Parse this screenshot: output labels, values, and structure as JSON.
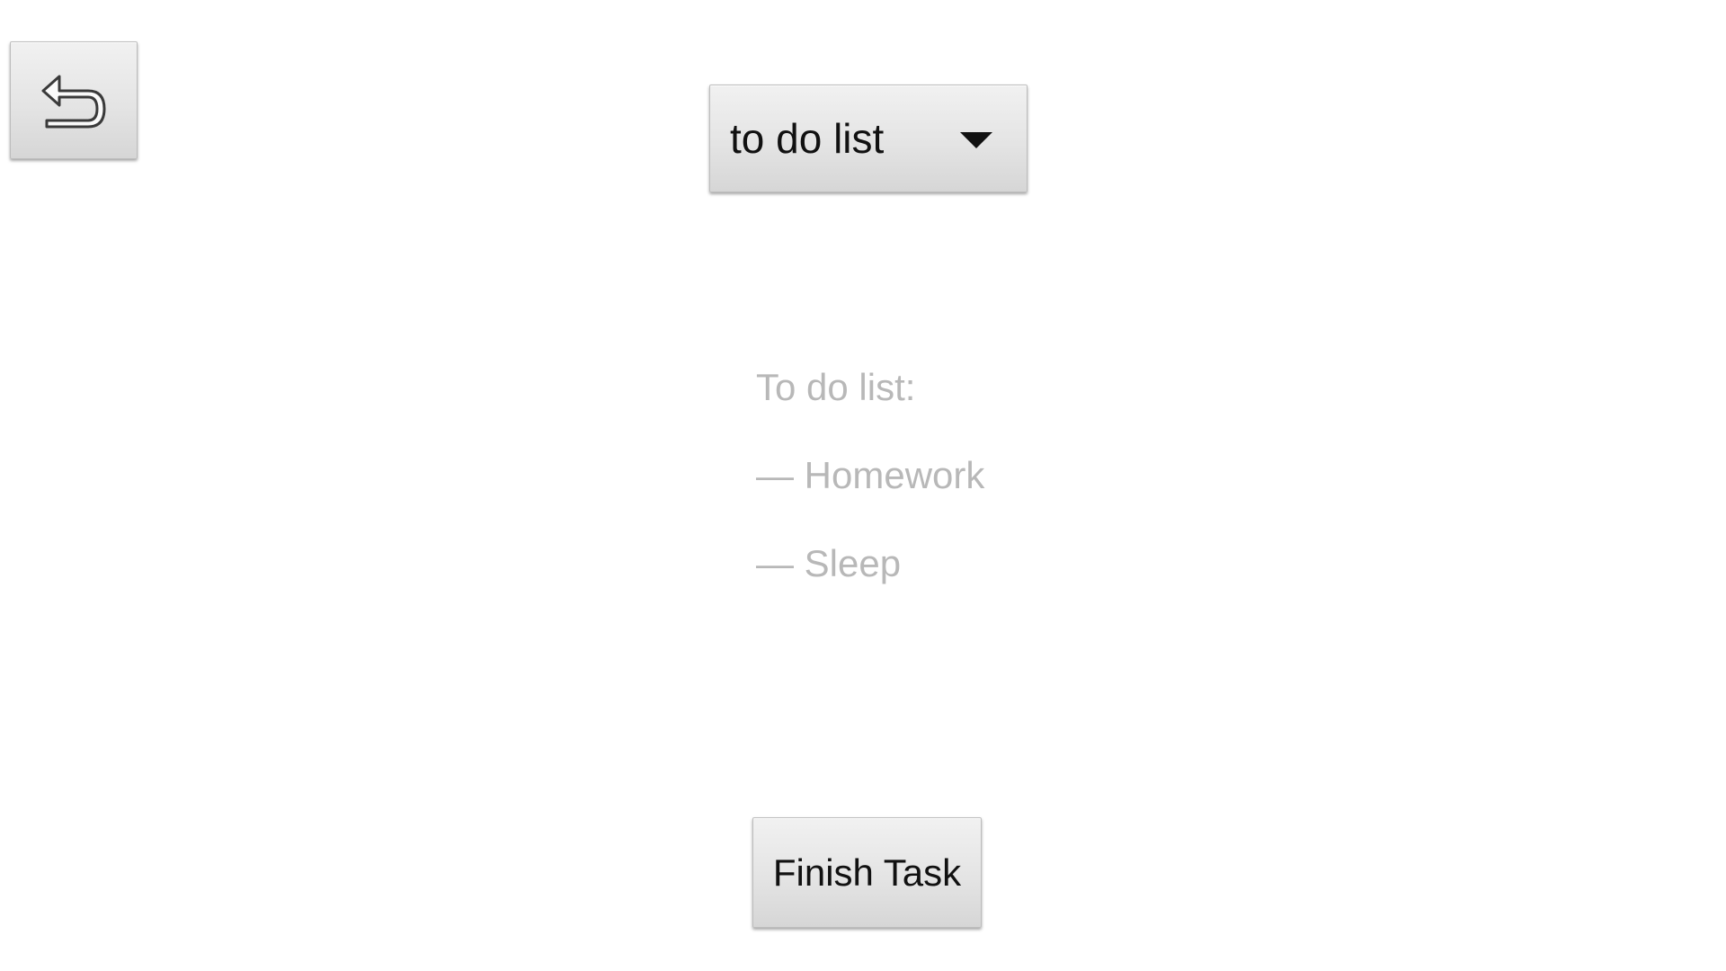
{
  "toolbar": {
    "back_icon": "undo-arrow-icon"
  },
  "list_selector": {
    "selected": "to do list",
    "icon": "chevron-down-icon"
  },
  "content": {
    "heading": "To do list:",
    "items": [
      "— Homework",
      "— Sleep"
    ],
    "text_color": "#b8b8b8"
  },
  "actions": {
    "finish_label": "Finish Task"
  }
}
